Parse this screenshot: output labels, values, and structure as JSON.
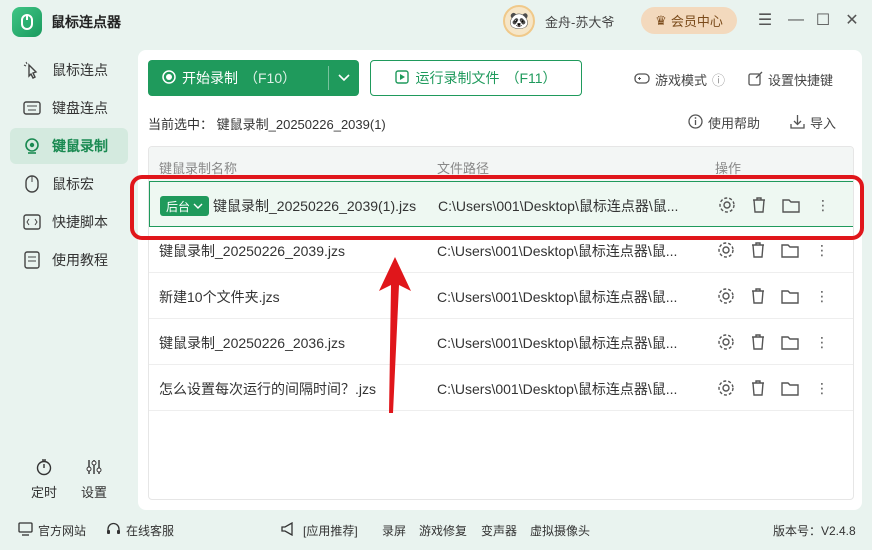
{
  "app": {
    "title": "鼠标连点器",
    "user_name": "金舟-苏大爷",
    "vip_label": "会员中心"
  },
  "sidebar": {
    "items": [
      {
        "label": "鼠标连点"
      },
      {
        "label": "键盘连点"
      },
      {
        "label": "键鼠录制"
      },
      {
        "label": "鼠标宏"
      },
      {
        "label": "快捷脚本"
      },
      {
        "label": "使用教程"
      }
    ],
    "active_index": 2,
    "bottom": {
      "timer_label": "定时",
      "settings_label": "设置"
    }
  },
  "toolbar": {
    "start_label": "开始录制",
    "start_hotkey": "（F10）",
    "run_label": "运行录制文件",
    "run_hotkey": "（F11）",
    "game_mode_label": "游戏模式",
    "shortcut_label": "设置快捷键",
    "help_label": "使用帮助",
    "import_label": "导入"
  },
  "current_selection": {
    "prefix": "当前选中：",
    "value": "键鼠录制_20250226_2039(1)"
  },
  "table": {
    "columns": [
      "键鼠录制名称",
      "文件路径",
      "操作"
    ],
    "badge_label": "后台",
    "rows": [
      {
        "name": "键鼠录制_20250226_2039(1).jzs",
        "path": "C:\\Users\\001\\Desktop\\鼠标连点器\\鼠...",
        "selected": true
      },
      {
        "name": "键鼠录制_20250226_2039.jzs",
        "path": "C:\\Users\\001\\Desktop\\鼠标连点器\\鼠...",
        "selected": false
      },
      {
        "name": "新建10个文件夹.jzs",
        "path": "C:\\Users\\001\\Desktop\\鼠标连点器\\鼠...",
        "selected": false
      },
      {
        "name": "键鼠录制_20250226_2036.jzs",
        "path": "C:\\Users\\001\\Desktop\\鼠标连点器\\鼠...",
        "selected": false
      },
      {
        "name": "怎么设置每次运行的间隔时间？.jzs",
        "path": "C:\\Users\\001\\Desktop\\鼠标连点器\\鼠...",
        "selected": false
      }
    ]
  },
  "footer": {
    "website_label": "官方网站",
    "service_label": "在线客服",
    "recommend_label": "[应用推荐]",
    "rec_items": [
      "录屏",
      "游戏修复",
      "变声器",
      "虚拟摄像头"
    ],
    "version": "版本号：V2.4.8"
  },
  "colors": {
    "accent": "#1f9a5c",
    "highlight": "#e0161b",
    "background": "#e9f3ef"
  }
}
